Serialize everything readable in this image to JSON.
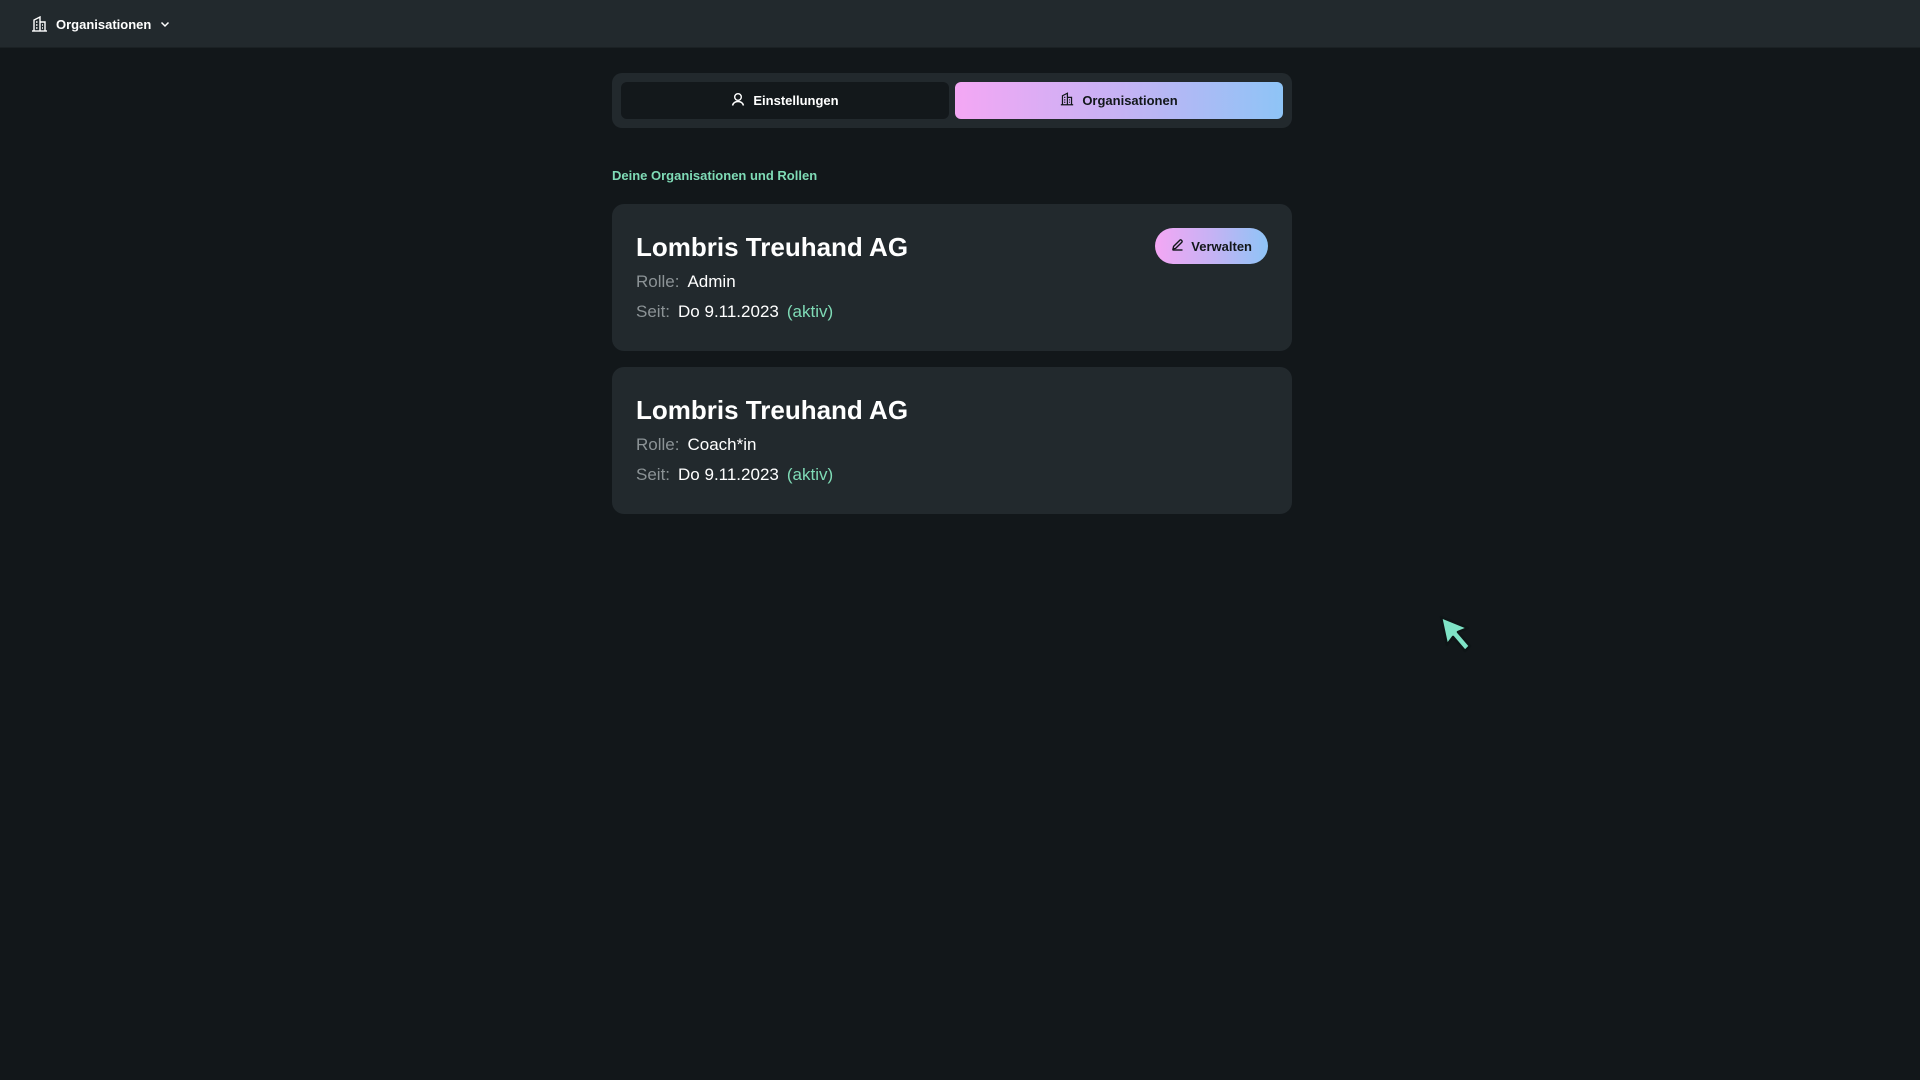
{
  "topbar": {
    "switcher_label": "Organisationen",
    "switcher_icon": "building-icon",
    "chevron_icon": "chevron-down-icon"
  },
  "tabs": [
    {
      "label": "Einstellungen",
      "icon": "user-icon",
      "active": false
    },
    {
      "label": "Organisationen",
      "icon": "building-icon",
      "active": true
    }
  ],
  "section": {
    "title": "Deine Organisationen und Rollen"
  },
  "labels": {
    "role": "Rolle:",
    "since": "Seit:"
  },
  "organizations": [
    {
      "name": "Lombris Treuhand AG",
      "role": "Admin",
      "since": "Do 9.11.2023",
      "status": "(aktiv)",
      "manage_label": "Verwalten",
      "manage_icon": "edit-icon"
    },
    {
      "name": "Lombris Treuhand AG",
      "role": "Coach*in",
      "since": "Do 9.11.2023",
      "status": "(aktiv)"
    }
  ],
  "colors": {
    "background": "#12171a",
    "surface": "#22292d",
    "accent_green": "#7fdbb6",
    "gradient_start": "#f4a7f4",
    "gradient_end": "#8ec4f6"
  }
}
